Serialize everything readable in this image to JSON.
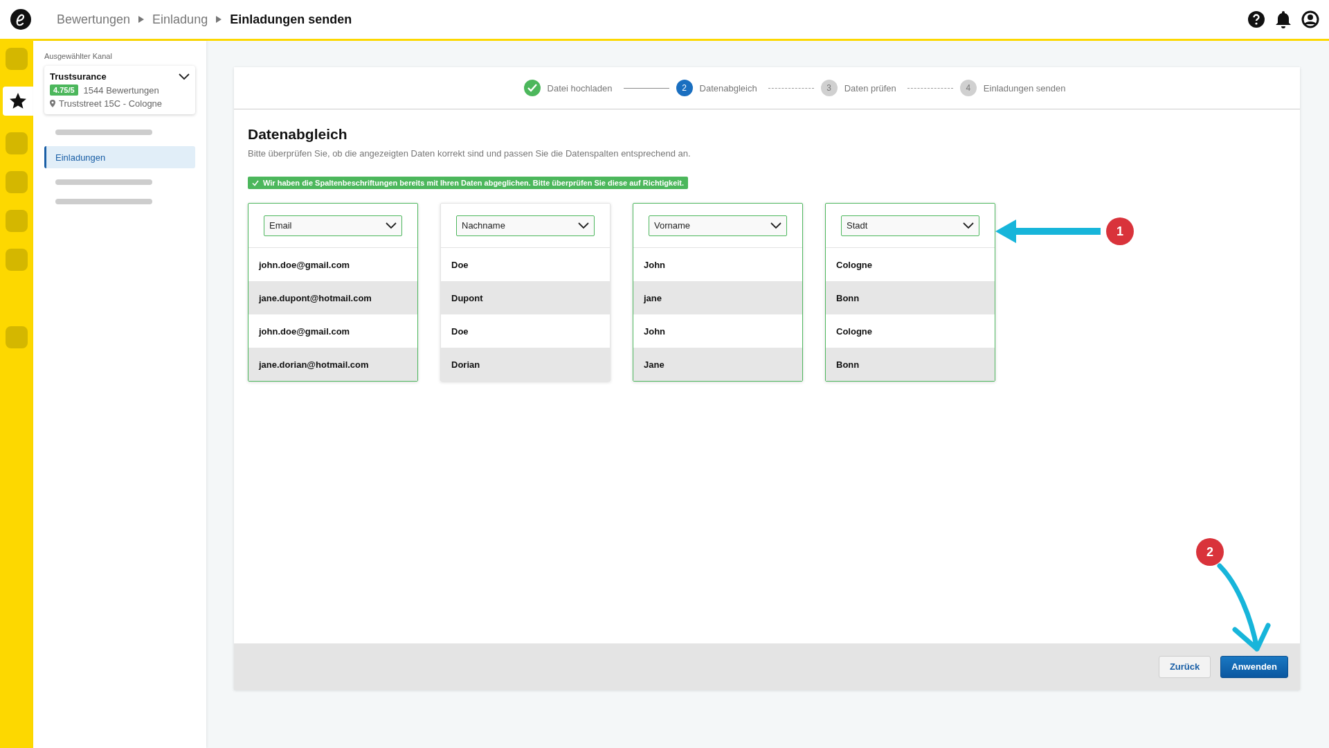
{
  "breadcrumb": [
    {
      "label": "Bewertungen",
      "current": false
    },
    {
      "label": "Einladung",
      "current": false
    },
    {
      "label": "Einladungen senden",
      "current": true
    }
  ],
  "rail": [
    {
      "kind": "blank",
      "selected": false
    },
    {
      "kind": "star",
      "selected": true
    },
    {
      "kind": "blank",
      "selected": false
    },
    {
      "kind": "blank",
      "selected": false
    },
    {
      "kind": "blank",
      "selected": false
    },
    {
      "kind": "blank",
      "selected": false
    },
    {
      "kind": "blank",
      "selected": false
    }
  ],
  "channel": {
    "caption": "Ausgewählter Kanal",
    "name": "Trustsurance",
    "rating": "4.75/5",
    "reviews": "1544 Bewertungen",
    "address": "Truststreet 15C - Cologne"
  },
  "nav": [
    {
      "kind": "placeholder"
    },
    {
      "kind": "item",
      "label": "Einladungen",
      "selected": true
    },
    {
      "kind": "placeholder"
    },
    {
      "kind": "placeholder"
    }
  ],
  "steps": [
    {
      "label": "Datei hochladen",
      "completed": true,
      "current": false
    },
    {
      "label": "Datenabgleich",
      "number": "2",
      "completed": false,
      "current": true
    },
    {
      "label": "Daten prüfen",
      "number": "3",
      "completed": false,
      "current": false
    },
    {
      "label": "Einladungen senden",
      "number": "4",
      "completed": false,
      "current": false
    }
  ],
  "title": "Datenabgleich",
  "description": "Bitte überprüfen Sie, ob die angezeigten Daten korrekt sind und passen Sie die Datenspalten entsprechend an.",
  "notice": "Wir haben die Spaltenbeschriftungen bereits mit Ihren Daten abgeglichen. Bitte überprüfen Sie diese auf Richtigkeit.",
  "columns": [
    {
      "field": "Email",
      "matched": true,
      "values": [
        "john.doe@gmail.com",
        "jane.dupont@hotmail.com",
        "john.doe@gmail.com",
        "jane.dorian@hotmail.com"
      ]
    },
    {
      "field": "Nachname",
      "matched": false,
      "values": [
        "Doe",
        "Dupont",
        "Doe",
        "Dorian"
      ]
    },
    {
      "field": "Vorname",
      "matched": true,
      "values": [
        "John",
        "jane",
        "John",
        "Jane"
      ]
    },
    {
      "field": "Stadt",
      "matched": true,
      "values": [
        "Cologne",
        "Bonn",
        "Cologne",
        "Bonn"
      ]
    }
  ],
  "annotations": [
    "1",
    "2"
  ],
  "buttons": [
    {
      "label": "Zurück",
      "kind": "secondary"
    },
    {
      "label": "Anwenden",
      "kind": "primary"
    }
  ]
}
